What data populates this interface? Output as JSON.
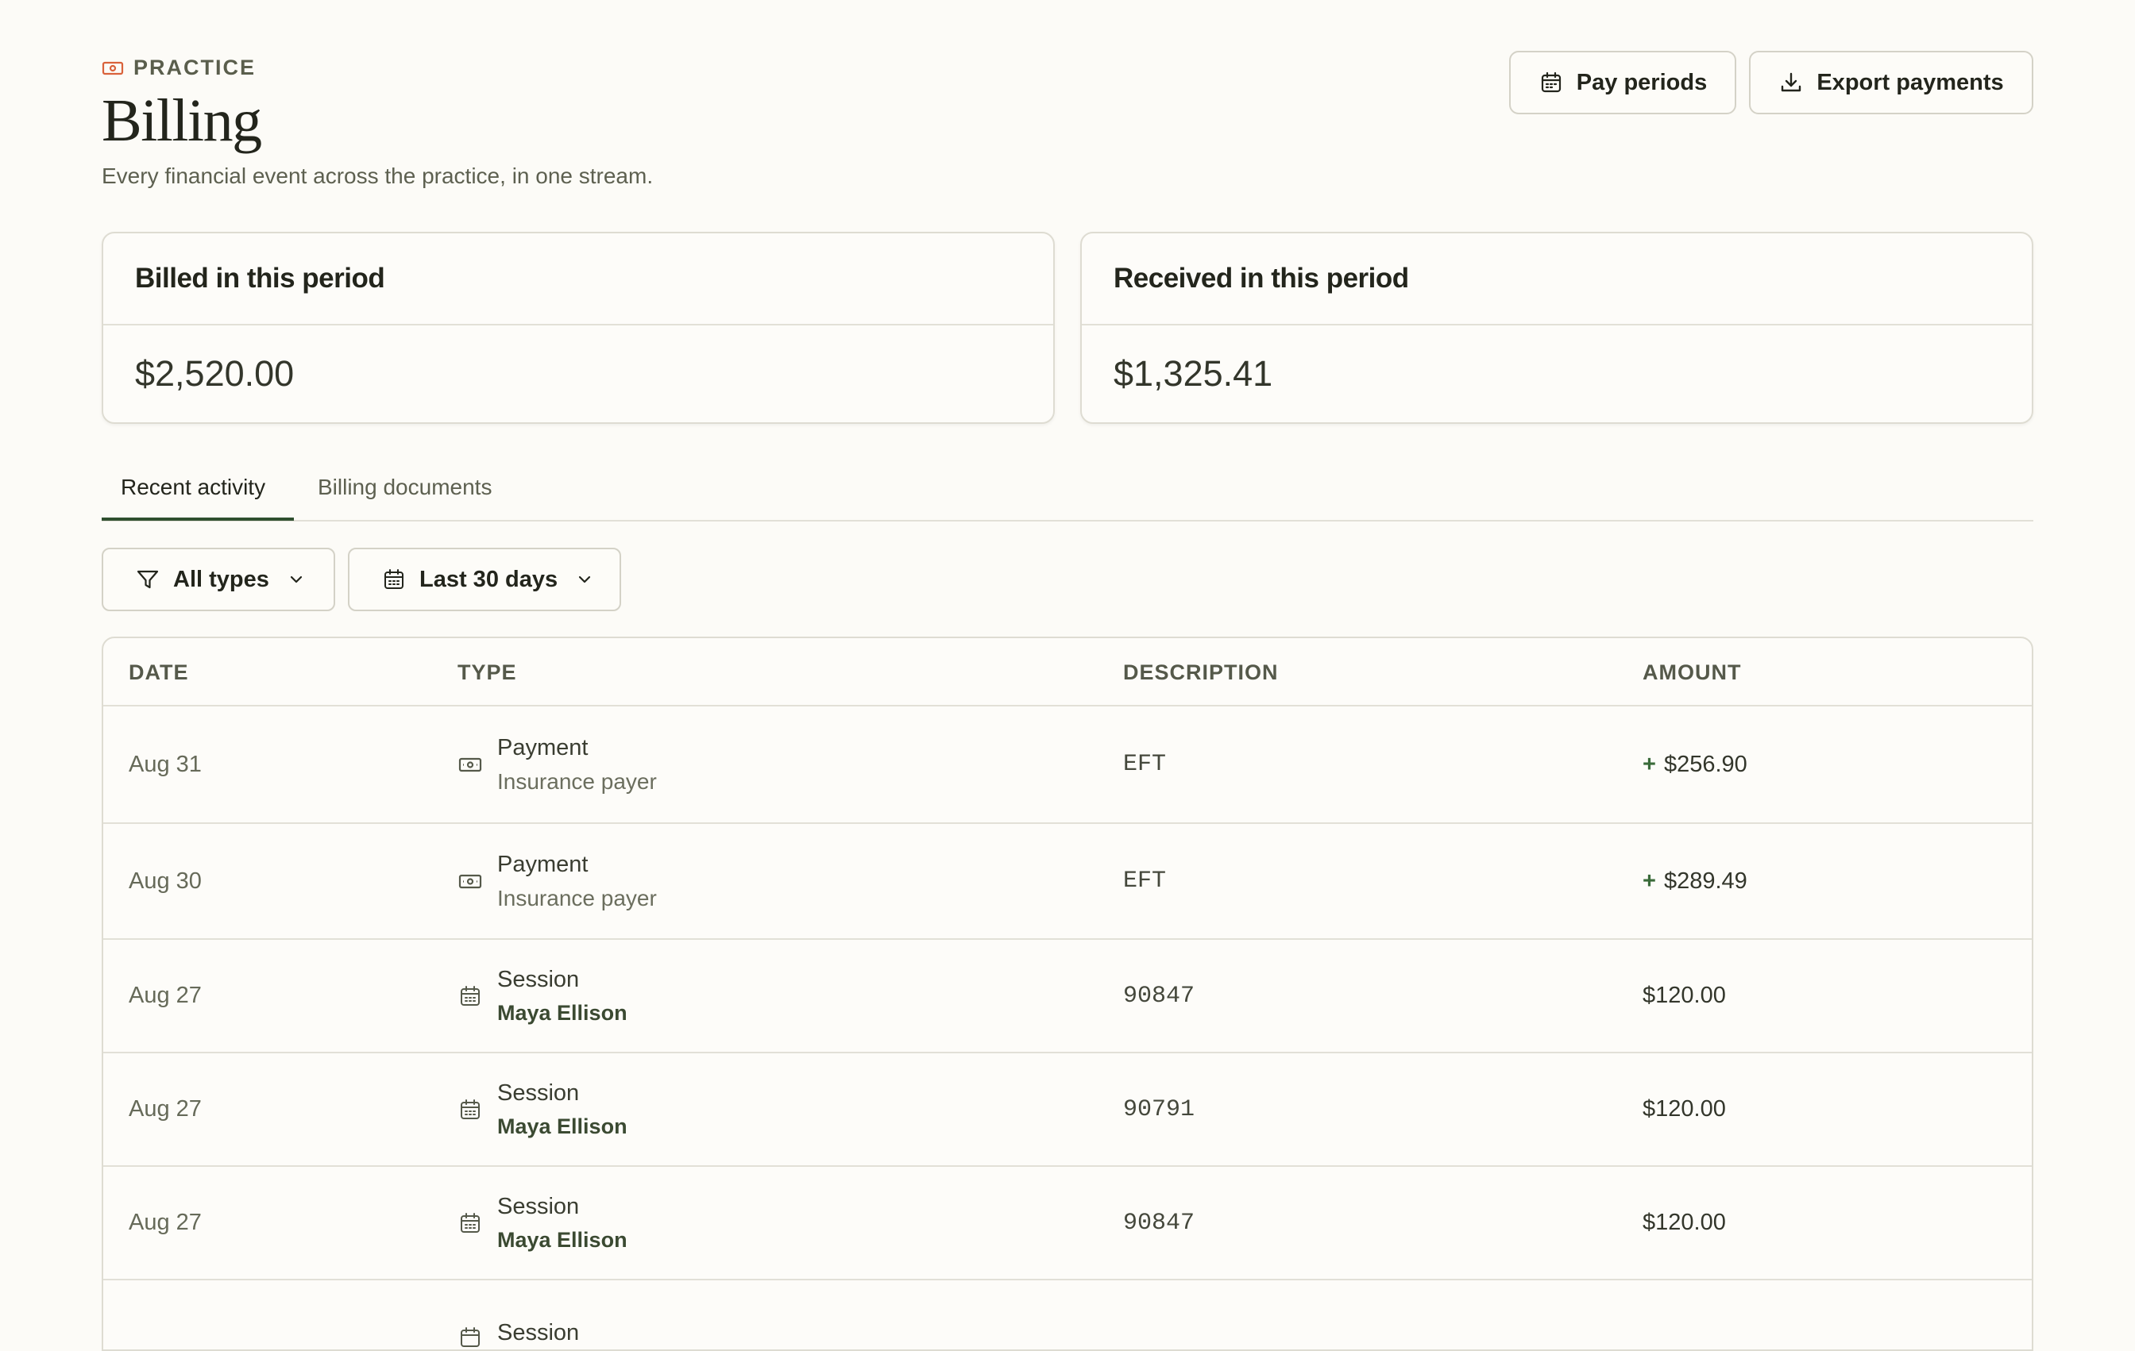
{
  "header": {
    "eyebrow": "PRACTICE",
    "title": "Billing",
    "subtitle": "Every financial event across the practice, in one stream.",
    "pay_periods_label": "Pay periods",
    "export_label": "Export payments"
  },
  "stats": {
    "billed_label": "Billed in this period",
    "billed_value": "$2,520.00",
    "received_label": "Received in this period",
    "received_value": "$1,325.41"
  },
  "tabs": [
    {
      "label": "Recent activity",
      "active": true
    },
    {
      "label": "Billing documents",
      "active": false
    }
  ],
  "filters": {
    "type_label": "All types",
    "date_label": "Last 30 days"
  },
  "table": {
    "columns": [
      "DATE",
      "TYPE",
      "DESCRIPTION",
      "AMOUNT"
    ],
    "rows": [
      {
        "date": "Aug 31",
        "type": "Payment",
        "sub": "Insurance payer",
        "description": "EFT",
        "sign": "+",
        "amount": "$256.90"
      },
      {
        "date": "Aug 30",
        "type": "Payment",
        "sub": "Insurance payer",
        "description": "EFT",
        "sign": "+",
        "amount": "$289.49"
      },
      {
        "date": "Aug 27",
        "type": "Session",
        "sub": "Maya Ellison",
        "description": "90847",
        "sign": "",
        "amount": "$120.00"
      },
      {
        "date": "Aug 27",
        "type": "Session",
        "sub": "Maya Ellison",
        "description": "90791",
        "sign": "",
        "amount": "$120.00"
      },
      {
        "date": "Aug 27",
        "type": "Session",
        "sub": "Maya Ellison",
        "description": "90847",
        "sign": "",
        "amount": "$120.00"
      },
      {
        "date": "",
        "type": "Session",
        "sub": "",
        "description": "",
        "sign": "",
        "amount": ""
      }
    ]
  },
  "icons": {
    "eyebrow": "banknote-icon",
    "pay_periods": "calendar-icon",
    "export": "download-icon",
    "filter": "funnel-icon",
    "date_filter": "calendar-icon",
    "payment_row": "banknote-icon",
    "session_row": "calendar-icon"
  },
  "colors": {
    "background": "#fcfbf7",
    "accent": "#2f4f2f",
    "eyebrow_icon": "#d9623b",
    "positive": "#3a6b3a"
  }
}
